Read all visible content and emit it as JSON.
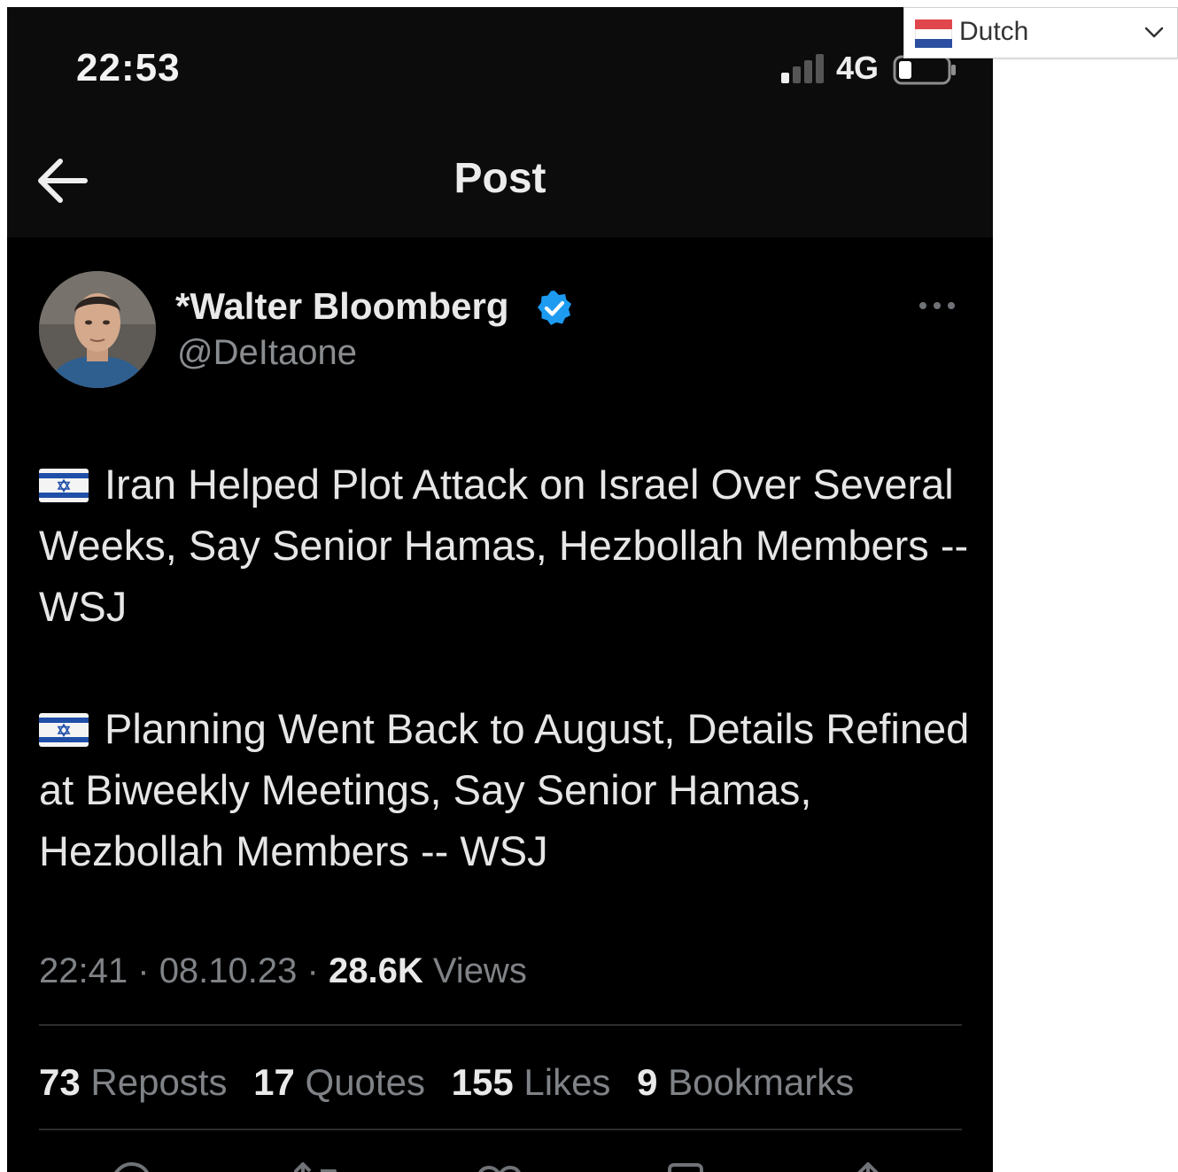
{
  "status_bar": {
    "time": "22:53",
    "network": "4G"
  },
  "header": {
    "title": "Post"
  },
  "author": {
    "display_name": "*Walter Bloomberg",
    "handle": "@DeItaone"
  },
  "post": {
    "paragraphs": [
      "Iran Helped Plot Attack on Israel Over Several Weeks, Say Senior Hamas, Hezbollah Members -- WSJ",
      "Planning Went Back to August, Details Refined at Biweekly Meetings, Say Senior Hamas, Hezbollah Members -- WSJ"
    ],
    "time": "22:41",
    "separator": "·",
    "date": "08.10.23",
    "views_count": "28.6K",
    "views_label": "Views"
  },
  "stats": [
    {
      "count": "73",
      "label": "Reposts"
    },
    {
      "count": "17",
      "label": "Quotes"
    },
    {
      "count": "155",
      "label": "Likes"
    },
    {
      "count": "9",
      "label": "Bookmarks"
    }
  ],
  "language_selector": {
    "selected": "Dutch"
  },
  "colors": {
    "background": "#000000",
    "verified_badge": "#1d9bf0",
    "text_primary": "#e9e9e9",
    "text_secondary": "#7f8286"
  }
}
